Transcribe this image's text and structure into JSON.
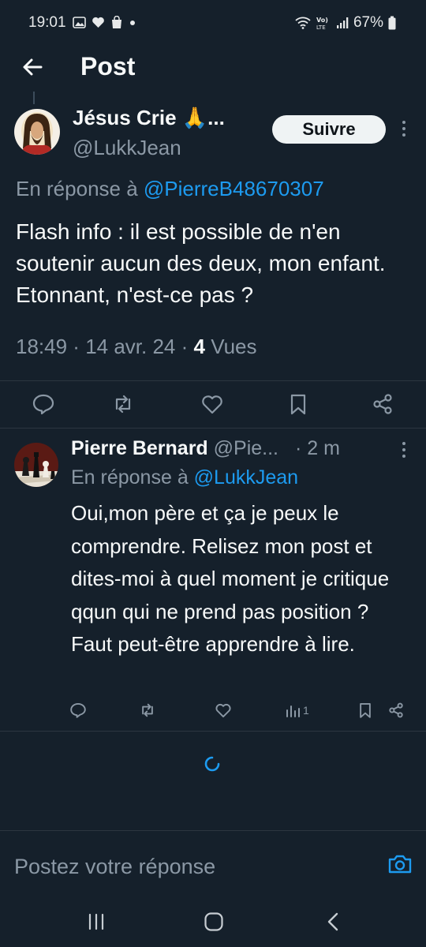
{
  "status_bar": {
    "time": "19:01",
    "battery": "67%",
    "left_icons": [
      "gallery-icon",
      "heart-icon",
      "shopping-bag-icon",
      "dot-icon"
    ],
    "right_icons": [
      "wifi-icon",
      "volte-icon",
      "signal-icon",
      "battery-icon"
    ]
  },
  "header": {
    "title": "Post"
  },
  "main_post": {
    "author_name": "Jésus Crie 🙏...",
    "handle": "@LukkJean",
    "follow_label": "Suivre",
    "reply_prefix": "En réponse à ",
    "reply_to": "@PierreB48670307",
    "text": "Flash info : il est possible de n'en soutenir aucun des deux, mon enfant. Etonnant, n'est-ce pas ?",
    "time": "18:49",
    "date": "14 avr. 24",
    "views_count": "4",
    "views_label": "Vues",
    "sep": " · "
  },
  "reply": {
    "author_name": "Pierre Bernard",
    "handle": "@Pie...",
    "age": "· 2 m",
    "reply_prefix": "En réponse à ",
    "reply_to": "@LukkJean",
    "text": "Oui,mon père et ça je peux le comprendre. Relisez mon post et dites-moi à quel moment je critique qqun qui ne prend pas position ? Faut peut-être apprendre à lire.",
    "views": "1"
  },
  "composer": {
    "placeholder": "Postez votre réponse"
  },
  "colors": {
    "background": "#15202b",
    "accent": "#1d9bf0",
    "muted": "#8b98a5",
    "text": "#f7f9f9"
  }
}
